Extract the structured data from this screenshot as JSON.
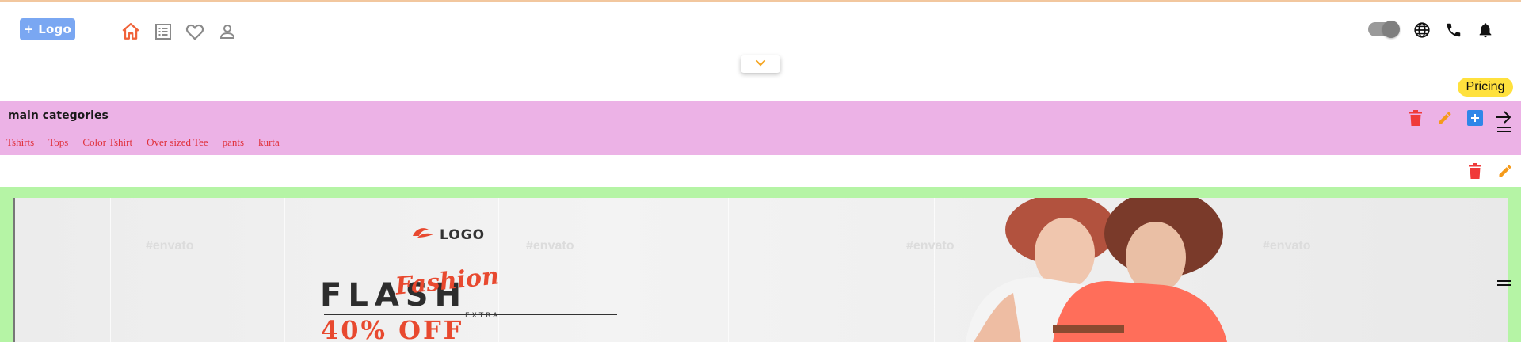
{
  "header": {
    "logo_label": "+ Logo",
    "nav_icons": [
      "home-icon",
      "list-icon",
      "heart-icon",
      "user-icon"
    ],
    "right_icons": [
      "toggle-switch",
      "globe-icon",
      "phone-icon",
      "bell-icon"
    ],
    "collapse_icon": "chevron-down-icon",
    "pricing_label": "Pricing"
  },
  "categories": {
    "title": "main categories",
    "items": [
      "Tshirts",
      "Tops",
      "Color Tshirt",
      "Over sized Tee",
      "pants",
      "kurta"
    ],
    "actions": [
      "delete-icon",
      "edit-icon",
      "add-icon",
      "arrow-right-icon"
    ]
  },
  "banner_section": {
    "actions": [
      "delete-icon",
      "edit-icon"
    ],
    "banner": {
      "logo_text": "LOGO",
      "script_text": "Fashion",
      "headline": "FLASH",
      "sub": "EXTRA",
      "offer": "40% OFF",
      "watermark": "envato"
    }
  },
  "colors": {
    "accent_home": "#f0633a",
    "logo_button": "#7aa7f2",
    "pricing": "#ffe13d",
    "category_band": "#ecb2e6",
    "category_link": "#e0303a",
    "banner_border": "#b5f4a5",
    "delete": "#f03a3a",
    "edit": "#f59a1a",
    "add": "#2f86e8"
  }
}
